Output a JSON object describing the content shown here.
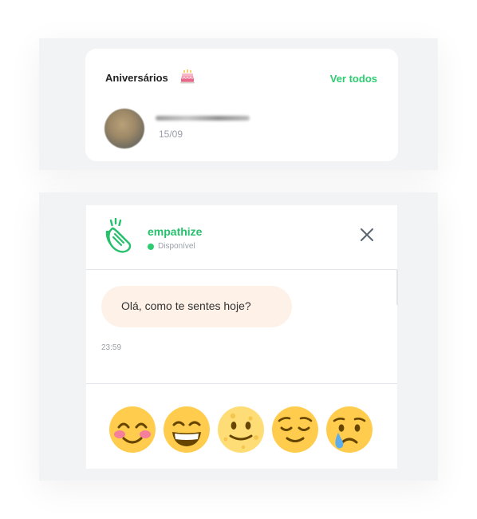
{
  "birthdays": {
    "title": "Aniversários",
    "title_icon": "birthday-cake-icon",
    "see_all_label": "Ver todos",
    "entries": [
      {
        "date": "15/09"
      }
    ]
  },
  "chat": {
    "logo_icon": "clapping-hands-icon",
    "bot_name": "empathize",
    "status": "Disponível",
    "status_color": "#2ecc71",
    "messages": [
      {
        "text": "Olá, como te sentes hoje?",
        "time": "23:59"
      }
    ],
    "mood_options": [
      "smiling-face-with-blush-icon",
      "grinning-face-icon",
      "slightly-smiling-face-icon",
      "relieved-face-icon",
      "crying-face-icon"
    ]
  },
  "colors": {
    "accent": "#2ecc71",
    "bubble": "#fdf1e8",
    "emoji": "#ffcc4d"
  }
}
